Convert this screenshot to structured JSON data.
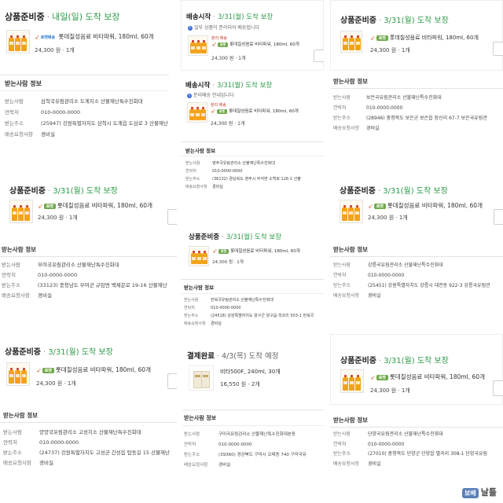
{
  "panels": [
    {
      "card": {
        "status": "상품준비중",
        "eta": "내일(일) 도착 보장",
        "tag_text": "로켓배송",
        "product": "롯데칠성음료 비타파워, 180ml, 60개",
        "price": "24,300 원 · 1개"
      },
      "recipient": {
        "title": "받는사람 정보",
        "rows": [
          {
            "k": "받는사람",
            "v": "삼척국유림관리소 도계지소 산불재난특수진화대"
          },
          {
            "k": "연락처",
            "v": "010-0000-0000"
          },
          {
            "k": "받는주소",
            "v": "(25947) 강원특별자치도 삼척시 도계읍 도삼로 3 산불재난"
          },
          {
            "k": "배송요청사항",
            "v": "경비실"
          }
        ]
      }
    },
    {
      "cards": [
        {
          "status": "배송시작",
          "eta": "3/31(월) 도착 보장",
          "note": "일부 상품이 분리되어 배송됩니다",
          "tag_text": "분리 배송",
          "product": "롯데칠성음료 비타파워, 180ml, 60개",
          "price": "24,300 원 · 1개"
        },
        {
          "status": "배송시작",
          "eta": "3/31(월) 도착 보장",
          "note": "분리배송 안내입니다",
          "tag_text": "분리 배송",
          "product": "롯데칠성음료 비타파워, 180ml, 60개",
          "price": "24,300 원 · 1개"
        }
      ],
      "recipient": {
        "title": "받는사람 정보",
        "rows": [
          {
            "k": "받는사람",
            "v": "영주국유림관리소 산불재난특수진화대"
          },
          {
            "k": "연락처",
            "v": "010-0000-0000"
          },
          {
            "k": "받는주소",
            "v": "(36132) 경상북도 영주시 부석면 소백로 126-1 산불"
          },
          {
            "k": "배송요청사항",
            "v": "경비실"
          }
        ]
      }
    },
    {
      "card": {
        "status": "상품준비중",
        "eta": "3/31(월) 도착 보장",
        "tag_text": "로켓",
        "product": "롯데칠성음료 비타파워, 180ml, 60개",
        "price": "24,300 원 · 1개"
      },
      "recipient": {
        "title": "받는사람 정보",
        "rows": [
          {
            "k": "받는사람",
            "v": "보은국유림관리소 산불재난특수진화대"
          },
          {
            "k": "연락처",
            "v": "010-0000-0000"
          },
          {
            "k": "받는주소",
            "v": "(28946) 충청북도 보은군 보은읍 장신리 67-7 보은국유림관"
          },
          {
            "k": "배송요청사항",
            "v": "경비실"
          }
        ]
      }
    },
    {
      "card": {
        "status": "상품준비중",
        "eta": "3/31(월) 도착 보장",
        "tag_text": "로켓",
        "product": "롯데칠성음료 비타파워, 180ml, 60개",
        "price": "24,300 원 · 1개"
      },
      "recipient": {
        "title": "받는사람 정보",
        "rows": [
          {
            "k": "받는사람",
            "v": "부여국유림관리소 산불재난특수진화대"
          },
          {
            "k": "연락처",
            "v": "010-0000-0000"
          },
          {
            "k": "받는주소",
            "v": "(33123) 충청남도 부여군 규암면 백제문로 19-16 산불재난"
          },
          {
            "k": "배송요청사항",
            "v": "경비실"
          }
        ]
      }
    },
    {
      "card": {
        "status": "상품준비중",
        "eta": "3/31(월) 도착 보장",
        "tag_text": "로켓",
        "product": "롯데칠성음료 비타파워, 180ml, 60개",
        "price": "24,300 원 · 1개"
      },
      "recipient": {
        "title": "받는사람 정보",
        "rows": [
          {
            "k": "받는사람",
            "v": "한북국유림관리소 산불재난특수진화대"
          },
          {
            "k": "연락처",
            "v": "010-0000-0000"
          },
          {
            "k": "받는주소",
            "v": "(24518) 강원특별자치도 양구군 양구읍 학조리 503-1 한북국"
          },
          {
            "k": "배송요청사항",
            "v": "경비실"
          }
        ]
      }
    },
    {
      "card": {
        "status": "상품준비중",
        "eta": "3/31(월) 도착 보장",
        "tag_text": "로켓",
        "product": "롯데칠성음료 비타파워, 180ml, 60개",
        "price": "24,300 원 · 1개"
      },
      "recipient": {
        "title": "받는사람 정보",
        "rows": [
          {
            "k": "받는사람",
            "v": "강릉국유림관리소 산불재난특수진화대"
          },
          {
            "k": "연락처",
            "v": "010-0000-0000"
          },
          {
            "k": "받는주소",
            "v": "(25451) 강원특별자치도 강릉시 대전동 922-3 강릉국유림관"
          },
          {
            "k": "배송요청사항",
            "v": "경비실"
          }
        ]
      }
    },
    {
      "card": {
        "status": "상품준비중",
        "eta": "3/31(월) 도착 보장",
        "tag_text": "로켓",
        "product": "롯데칠성음료 비타파워, 180ml, 60개",
        "price": "24,300 원 · 1개"
      },
      "recipient": {
        "title": "받는사람 정보",
        "rows": [
          {
            "k": "받는사람",
            "v": "양양국유림관리소 고성지소 산불재난특수진화대"
          },
          {
            "k": "연락처",
            "v": "010-0000-0000"
          },
          {
            "k": "받는주소",
            "v": "(24737) 강원특별자치도 고성군 간성읍 탑동길 15 산불재난"
          },
          {
            "k": "배송요청사항",
            "v": "경비실"
          }
        ]
      }
    },
    {
      "card": {
        "status": "결제완료",
        "eta": "4/3(목) 도착 예정",
        "product": "비타500F, 240ml, 30개",
        "price": "16,550 원 · 2개"
      },
      "recipient": {
        "title": "받는사람 정보",
        "rows": [
          {
            "k": "받는사람",
            "v": "구미국유림관리소 산불재난특수진화대본동"
          },
          {
            "k": "연락처",
            "v": "010-0000-0000"
          },
          {
            "k": "받는주소",
            "v": "(39360) 경상북도 구미시 오태동 740 구미국유"
          },
          {
            "k": "배송요청사항",
            "v": "경비실"
          }
        ]
      }
    },
    {
      "card": {
        "status": "상품준비중",
        "eta": "3/31(월) 도착 보장",
        "tag_text": "로켓",
        "product": "롯데칠성음료 비타파워, 180ml, 60개",
        "price": "24,300 원 · 1개"
      },
      "recipient": {
        "title": "받는사람 정보",
        "rows": [
          {
            "k": "받는사람",
            "v": "단양국유림관리소 산불재난특수진화대"
          },
          {
            "k": "연락처",
            "v": "010-0000-0000"
          },
          {
            "k": "받는주소",
            "v": "(27010) 충청북도 단양군 단양읍 별곡리 308-1 단양국유림"
          },
          {
            "k": "배송요청사항",
            "v": "경비실"
          }
        ]
      }
    }
  ],
  "watermark": "보배 · 날틀",
  "watermark_text": "날틀",
  "watermark_logo": "보배"
}
